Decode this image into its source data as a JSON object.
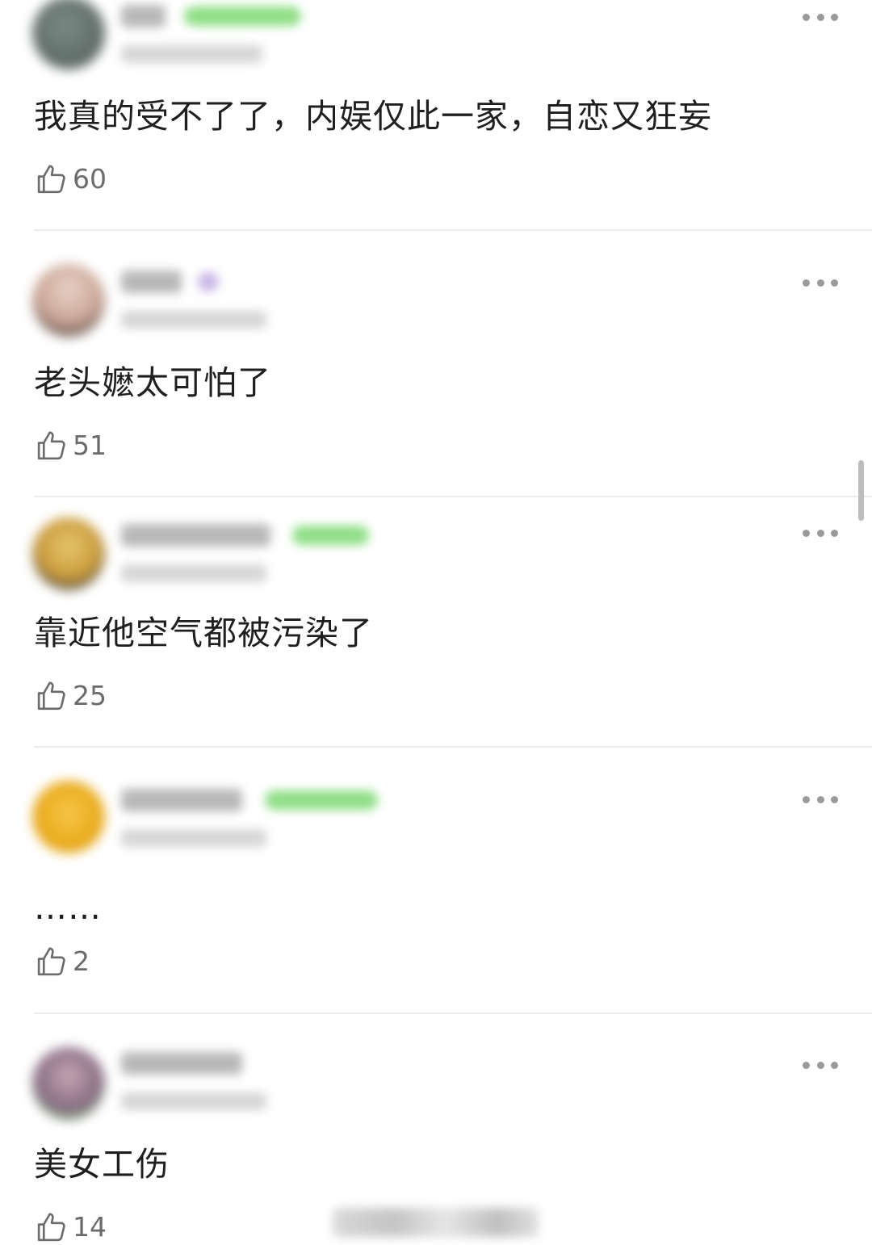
{
  "comments": [
    {
      "text": "我真的受不了了，内娱仅此一家，自恋又狂妄",
      "likes": "60"
    },
    {
      "text": "老头嬷太可怕了",
      "likes": "51"
    },
    {
      "text": "靠近他空气都被污染了",
      "likes": "25"
    },
    {
      "text": "……",
      "likes": "2"
    },
    {
      "text": "美女工伤",
      "likes": "14"
    }
  ],
  "colors": {
    "text": "#1f1f1f",
    "like_count": "#6b6b6b",
    "divider": "#ececec",
    "badge": "#8fde86"
  },
  "icons": {
    "like": "thumbs-up-icon",
    "more": "more-horizontal-icon"
  }
}
